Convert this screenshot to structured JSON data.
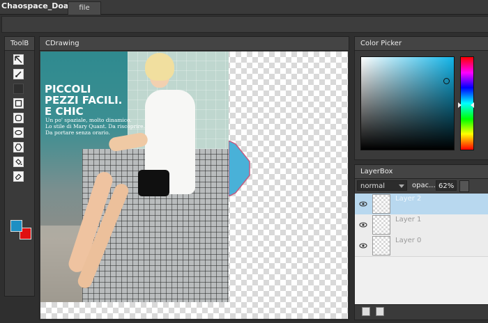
{
  "app": {
    "title": "Chaospace_Doard",
    "menu_file": "file"
  },
  "tools_panel": {
    "title": "ToolB",
    "tools": [
      "select-icon",
      "brush-icon",
      "blank-icon",
      "rectangle-icon",
      "rounded-rectangle-icon",
      "ellipse-icon",
      "polygon-icon",
      "fill-bucket-icon",
      "eraser-icon"
    ],
    "foreground_color": "#1e8fc3",
    "background_color": "#e01010"
  },
  "drawing_panel": {
    "title": "CDrawing",
    "image_text": {
      "headline": [
        "PICCOLI",
        "PEZZI FACILI.",
        "E CHIC"
      ],
      "subline": [
        "Un po' spaziale, molto dinamico.",
        "Lo stile di Mary Quant. Da riscoprire.",
        "Da portare senza orario."
      ]
    },
    "shape_fill": "#49b1d8"
  },
  "color_picker": {
    "title": "Color Picker",
    "selected_color": "#12b5e9"
  },
  "layer_box": {
    "title": "LayerBox",
    "blend_mode": "normal",
    "opacity_label": "opac...",
    "opacity_value": "62%",
    "layers": [
      {
        "name": "Layer 2",
        "selected": true
      },
      {
        "name": "Layer 1",
        "selected": false
      },
      {
        "name": "Layer 0",
        "selected": false
      }
    ]
  }
}
